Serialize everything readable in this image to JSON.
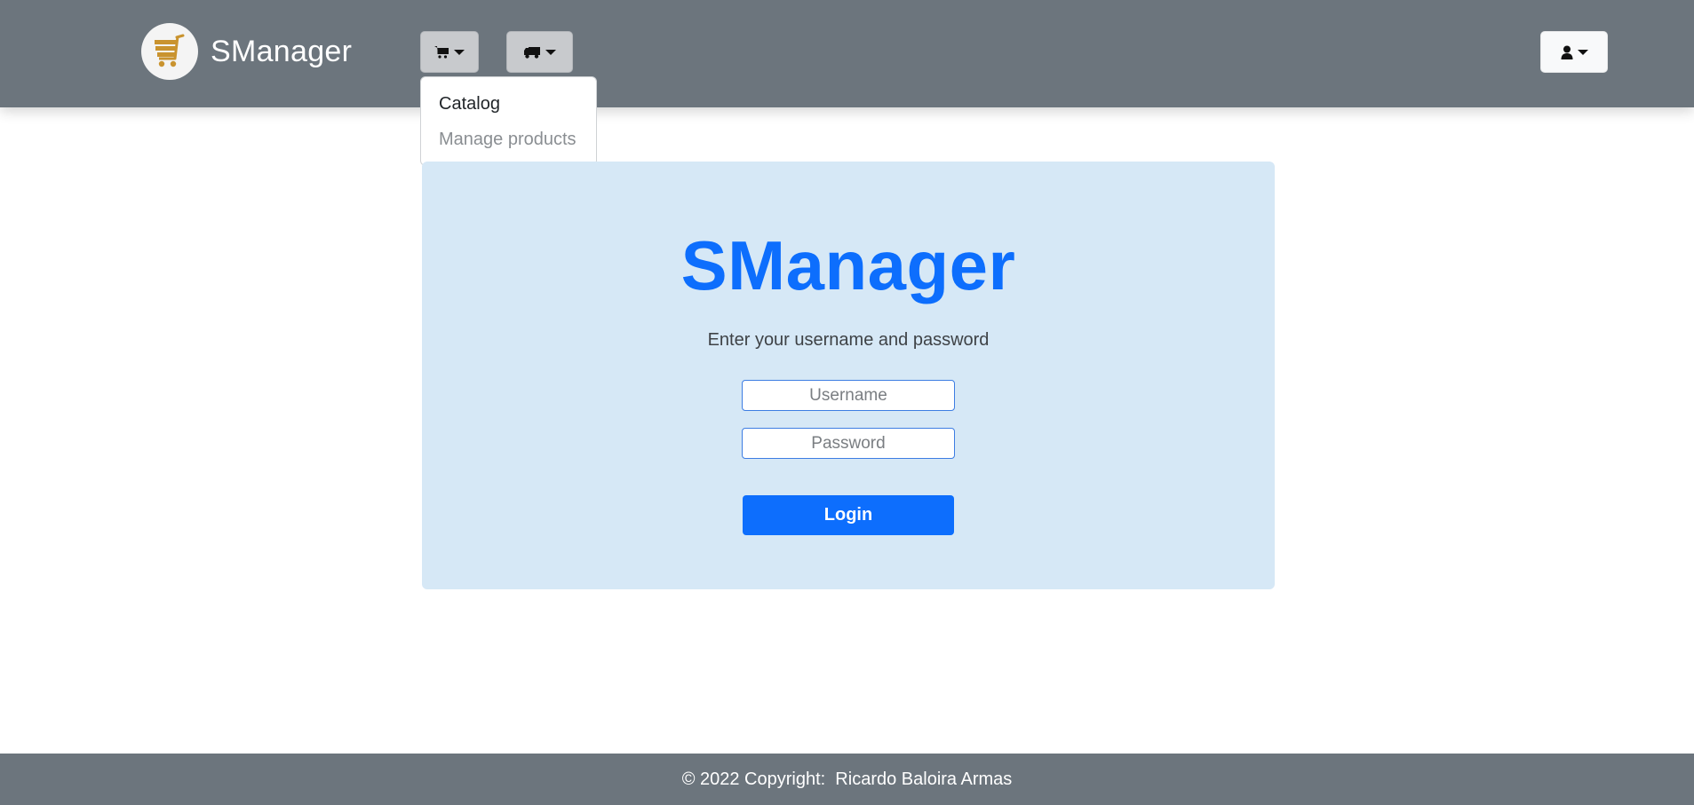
{
  "navbar": {
    "brand": "SManager",
    "logo_icon": "shopping-cart-icon",
    "shop_menu_icon": "shopping-cart-icon",
    "shipping_menu_icon": "truck-icon",
    "user_menu_icon": "user-icon",
    "shop_dropdown": {
      "items": [
        {
          "label": "Catalog"
        },
        {
          "label": "Manage products"
        }
      ]
    }
  },
  "login_card": {
    "title": "SManager",
    "subtitle": "Enter your username and password",
    "username_placeholder": "Username",
    "password_placeholder": "Password",
    "login_label": "Login"
  },
  "footer": {
    "copyright": "© 2022 Copyright:  Ricardo Baloira Armas"
  },
  "colors": {
    "navbar": "#6c757d",
    "primary": "#0d6efd",
    "card_bg": "#d6e8f6",
    "logo_cart": "#c9932f"
  }
}
